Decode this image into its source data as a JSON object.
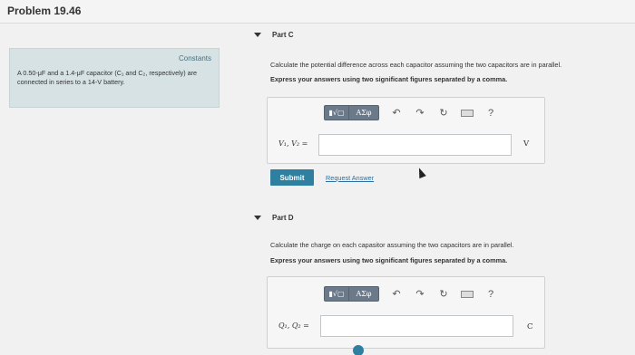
{
  "header": {
    "title": "Problem 19.46"
  },
  "constants": {
    "link_label": "Constants",
    "text": "A 0.50-μF and a 1.4-μF capacitor (C₁ and C₂, respectively) are connected in series to a 14-V battery."
  },
  "toolbar": {
    "sqrt_label": "▮√▢",
    "greek_label": "ΑΣφ",
    "undo_icon": "↶",
    "redo_icon": "↷",
    "reset_icon": "↻",
    "help_label": "?"
  },
  "part_c": {
    "label": "Part C",
    "question": "Calculate the potential difference across each capacitor assuming the two capacitors are in parallel.",
    "instruction": "Express your answers using two significant figures separated by a comma.",
    "input_label": "V₁, V₂ =",
    "input_value": "",
    "unit": "V",
    "submit_label": "Submit",
    "request_label": "Request Answer"
  },
  "part_d": {
    "label": "Part D",
    "question": "Calculate the charge on each capasitor assuming the two capacitors are in parallel.",
    "instruction": "Express your answers using two significant figures separated by a comma.",
    "input_label": "Q₁, Q₂ =",
    "input_value": "",
    "unit": "C"
  }
}
